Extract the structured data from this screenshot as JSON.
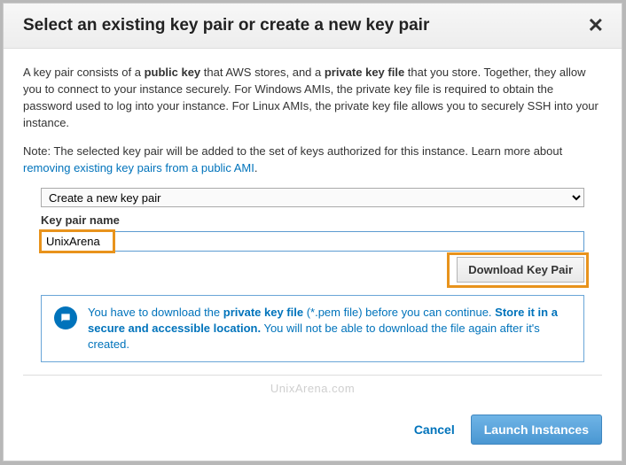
{
  "header": {
    "title": "Select an existing key pair or create a new key pair",
    "close": "✕"
  },
  "description": {
    "line1a": "A key pair consists of a ",
    "bold1": "public key",
    "line1b": " that AWS stores, and a ",
    "bold2": "private key file",
    "line1c": " that you store. Together, they allow you to connect to your instance securely. For Windows AMIs, the private key file is required to obtain the password used to log into your instance. For Linux AMIs, the private key file allows you to securely SSH into your instance."
  },
  "note": {
    "prefix": "Note: The selected key pair will be added to the set of keys authorized for this instance. Learn more about ",
    "link": "removing existing key pairs from a public AMI",
    "suffix": "."
  },
  "form": {
    "select_option": "Create a new key pair",
    "key_label": "Key pair name",
    "key_value": "UnixArena",
    "download_label": "Download Key Pair"
  },
  "info": {
    "t1": "You have to download the ",
    "b1": "private key file",
    "t2": " (*.pem file) before you can continue. ",
    "b2": "Store it in a secure and accessible location.",
    "t3": " You will not be able to download the file again after it's created."
  },
  "watermark": "UnixArena.com",
  "footer": {
    "cancel": "Cancel",
    "launch": "Launch Instances"
  }
}
